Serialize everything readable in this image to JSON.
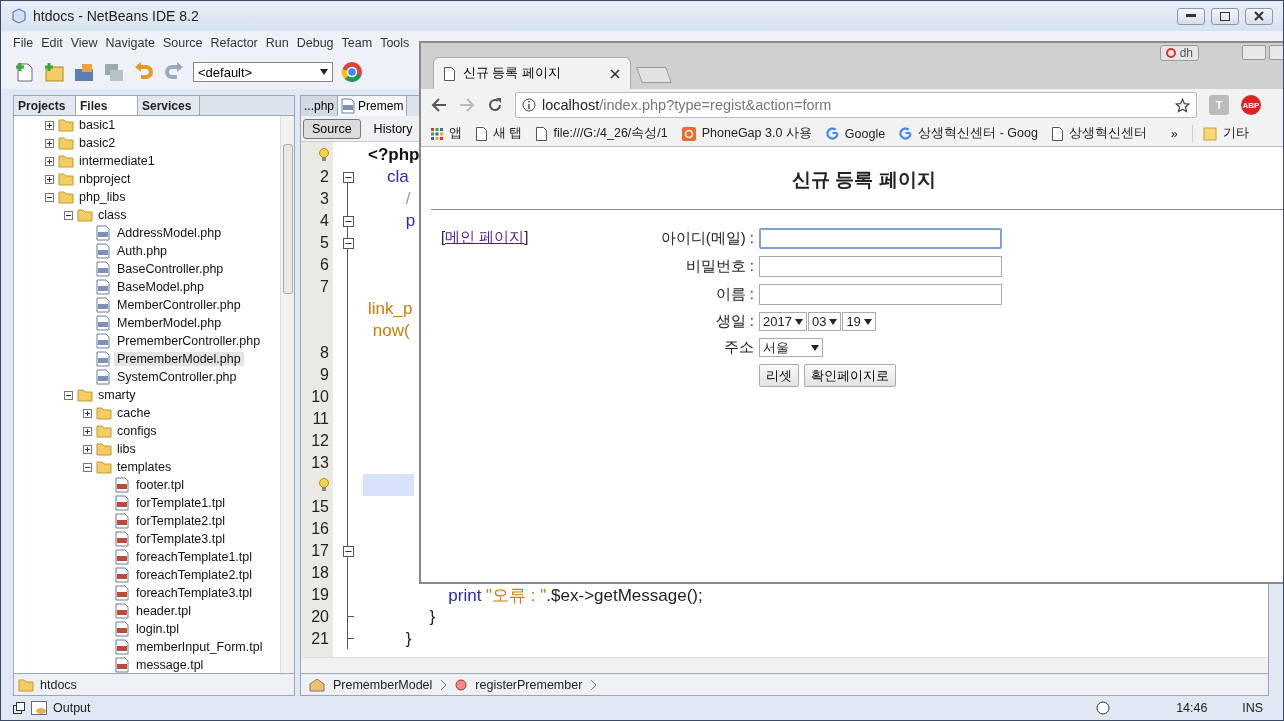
{
  "ide": {
    "title": "htdocs - NetBeans IDE 8.2",
    "menu": [
      "File",
      "Edit",
      "View",
      "Navigate",
      "Source",
      "Refactor",
      "Run",
      "Debug",
      "Team",
      "Tools"
    ],
    "config": "<default>"
  },
  "projects_panel": {
    "tabs": [
      {
        "label": "Projects",
        "selected": false
      },
      {
        "label": "Files",
        "selected": true
      },
      {
        "label": "Services",
        "selected": false
      }
    ],
    "tree": [
      {
        "label": "basic1",
        "kind": "folder",
        "expanded": false,
        "selected": false
      },
      {
        "label": "basic2",
        "kind": "folder",
        "expanded": false,
        "selected": false
      },
      {
        "label": "intermediate1",
        "kind": "folder",
        "expanded": false,
        "selected": false
      },
      {
        "label": "nbproject",
        "kind": "folder",
        "expanded": false,
        "selected": false
      },
      {
        "label": "php_libs",
        "kind": "folder",
        "expanded": true,
        "selected": false,
        "children": [
          {
            "label": "class",
            "kind": "folder",
            "expanded": true,
            "selected": false,
            "children": [
              {
                "label": "AddressModel.php",
                "kind": "php",
                "selected": false
              },
              {
                "label": "Auth.php",
                "kind": "php",
                "selected": false
              },
              {
                "label": "BaseController.php",
                "kind": "php",
                "selected": false
              },
              {
                "label": "BaseModel.php",
                "kind": "php",
                "selected": false
              },
              {
                "label": "MemberController.php",
                "kind": "php",
                "selected": false
              },
              {
                "label": "MemberModel.php",
                "kind": "php",
                "selected": false
              },
              {
                "label": "PrememberController.php",
                "kind": "php",
                "selected": false
              },
              {
                "label": "PrememberModel.php",
                "kind": "php",
                "selected": true
              },
              {
                "label": "SystemController.php",
                "kind": "php",
                "selected": false
              }
            ]
          },
          {
            "label": "smarty",
            "kind": "folder",
            "expanded": true,
            "selected": false,
            "children": [
              {
                "label": "cache",
                "kind": "folder",
                "expanded": false,
                "selected": false
              },
              {
                "label": "configs",
                "kind": "folder",
                "expanded": false,
                "selected": false
              },
              {
                "label": "libs",
                "kind": "folder",
                "expanded": false,
                "selected": false
              },
              {
                "label": "templates",
                "kind": "folder",
                "expanded": true,
                "selected": false,
                "children": [
                  {
                    "label": "footer.tpl",
                    "kind": "tpl",
                    "selected": false
                  },
                  {
                    "label": "forTemplate1.tpl",
                    "kind": "tpl",
                    "selected": false
                  },
                  {
                    "label": "forTemplate2.tpl",
                    "kind": "tpl",
                    "selected": false
                  },
                  {
                    "label": "forTemplate3.tpl",
                    "kind": "tpl",
                    "selected": false
                  },
                  {
                    "label": "foreachTemplate1.tpl",
                    "kind": "tpl",
                    "selected": false
                  },
                  {
                    "label": "foreachTemplate2.tpl",
                    "kind": "tpl",
                    "selected": false
                  },
                  {
                    "label": "foreachTemplate3.tpl",
                    "kind": "tpl",
                    "selected": false
                  },
                  {
                    "label": "header.tpl",
                    "kind": "tpl",
                    "selected": false
                  },
                  {
                    "label": "login.tpl",
                    "kind": "tpl",
                    "selected": false
                  },
                  {
                    "label": "memberInput_Form.tpl",
                    "kind": "tpl",
                    "selected": false
                  },
                  {
                    "label": "message.tpl",
                    "kind": "tpl",
                    "selected": false
                  }
                ]
              }
            ]
          }
        ]
      }
    ],
    "footer": "htdocs"
  },
  "editor": {
    "tabs": [
      {
        "label": "...php",
        "selected": false
      },
      {
        "label": "Premem",
        "selected": true
      }
    ],
    "views": [
      {
        "label": "Source",
        "selected": true
      },
      {
        "label": "History",
        "selected": false
      }
    ],
    "lines": [
      {
        "hint": true,
        "kind": "line",
        "highlighted": false,
        "segments": [
          {
            "kind": "tag",
            "text": "<?php"
          }
        ]
      },
      {
        "number": "2",
        "kind": "fold",
        "highlighted": false,
        "segments": [
          {
            "kind": "keyword",
            "text": "    cla"
          }
        ]
      },
      {
        "number": "3",
        "kind": "line",
        "highlighted": false,
        "segments": [
          {
            "kind": "comment",
            "text": "        /"
          }
        ]
      },
      {
        "number": "4",
        "kind": "fold",
        "highlighted": false,
        "segments": [
          {
            "kind": "keyword",
            "text": "        p"
          }
        ]
      },
      {
        "number": "5",
        "kind": "fold",
        "highlighted": false
      },
      {
        "number": "6",
        "kind": "line",
        "highlighted": false
      },
      {
        "number": "7",
        "kind": "line",
        "highlighted": false
      },
      {
        "kind": "line",
        "highlighted": false,
        "segments": [
          {
            "kind": "string",
            "text": "link_p"
          }
        ]
      },
      {
        "kind": "line",
        "highlighted": false,
        "segments": [
          {
            "kind": "string",
            "text": " now("
          }
        ]
      },
      {
        "number": "8",
        "kind": "line",
        "highlighted": false
      },
      {
        "number": "9",
        "kind": "line",
        "highlighted": false
      },
      {
        "number": "10",
        "kind": "line",
        "highlighted": false
      },
      {
        "number": "11",
        "kind": "line",
        "highlighted": false
      },
      {
        "number": "12",
        "kind": "line",
        "highlighted": false
      },
      {
        "number": "13",
        "kind": "line",
        "highlighted": false
      },
      {
        "hint": true,
        "kind": "line",
        "highlighted": true
      },
      {
        "number": "15",
        "kind": "line",
        "highlighted": false
      },
      {
        "number": "16",
        "kind": "line",
        "highlighted": false
      },
      {
        "number": "17",
        "kind": "fold",
        "highlighted": false
      },
      {
        "number": "18",
        "kind": "line",
        "highlighted": false
      },
      {
        "number": "19",
        "kind": "line",
        "highlighted": false,
        "segments": [
          {
            "kind": "keyword",
            "text": "                 print "
          },
          {
            "kind": "string",
            "text": "\"오류 : \""
          },
          {
            "kind": "plain",
            "text": ".$ex->getMessage();"
          }
        ]
      },
      {
        "number": "20",
        "kind": "end",
        "highlighted": false,
        "segments": [
          {
            "kind": "plain",
            "text": "             }"
          }
        ]
      },
      {
        "number": "21",
        "kind": "end",
        "highlighted": false,
        "segments": [
          {
            "kind": "plain",
            "text": "        }"
          }
        ]
      }
    ],
    "breadcrumbs": [
      "PrememberModel",
      "registerPremember"
    ]
  },
  "status_bar": {
    "output": "Output",
    "time": "14:46",
    "mode": "INS"
  },
  "browser": {
    "profile": "dh",
    "tab": "신규 등록 페이지",
    "url_host": "localhost",
    "url_path": "/index.php?type=regist&action=form",
    "extensions": [
      "T",
      "ABP"
    ],
    "bookmarks": [
      {
        "label": "앱",
        "kind": "apps"
      },
      {
        "label": "새 탭",
        "kind": "page"
      },
      {
        "label": "file:///G:/4_26/속성/1",
        "kind": "page"
      },
      {
        "label": "PhoneGap 3.0 사용",
        "kind": "phonegap"
      },
      {
        "label": "Google",
        "kind": "google"
      },
      {
        "label": "상생혁신센터 - Goog",
        "kind": "google"
      },
      {
        "label": "상생혁신센터",
        "kind": "page"
      }
    ],
    "more": "»",
    "other": "기타",
    "page": {
      "heading": "신규 등록 페이지",
      "link_before": "[",
      "link": "메인 페이지",
      "link_after": "]",
      "fields": [
        {
          "kind": "text",
          "label": "아이디(메일) :",
          "focused": true
        },
        {
          "kind": "text",
          "label": "비밀번호 :",
          "focused": false
        },
        {
          "kind": "text",
          "label": "이름 :",
          "focused": false
        },
        {
          "kind": "date",
          "label": "생일 :",
          "values": [
            "2017",
            "03",
            "19"
          ]
        },
        {
          "kind": "select",
          "label": "주소",
          "value": "서울"
        }
      ],
      "buttons": [
        "리셋",
        "확인페이지로"
      ]
    }
  }
}
